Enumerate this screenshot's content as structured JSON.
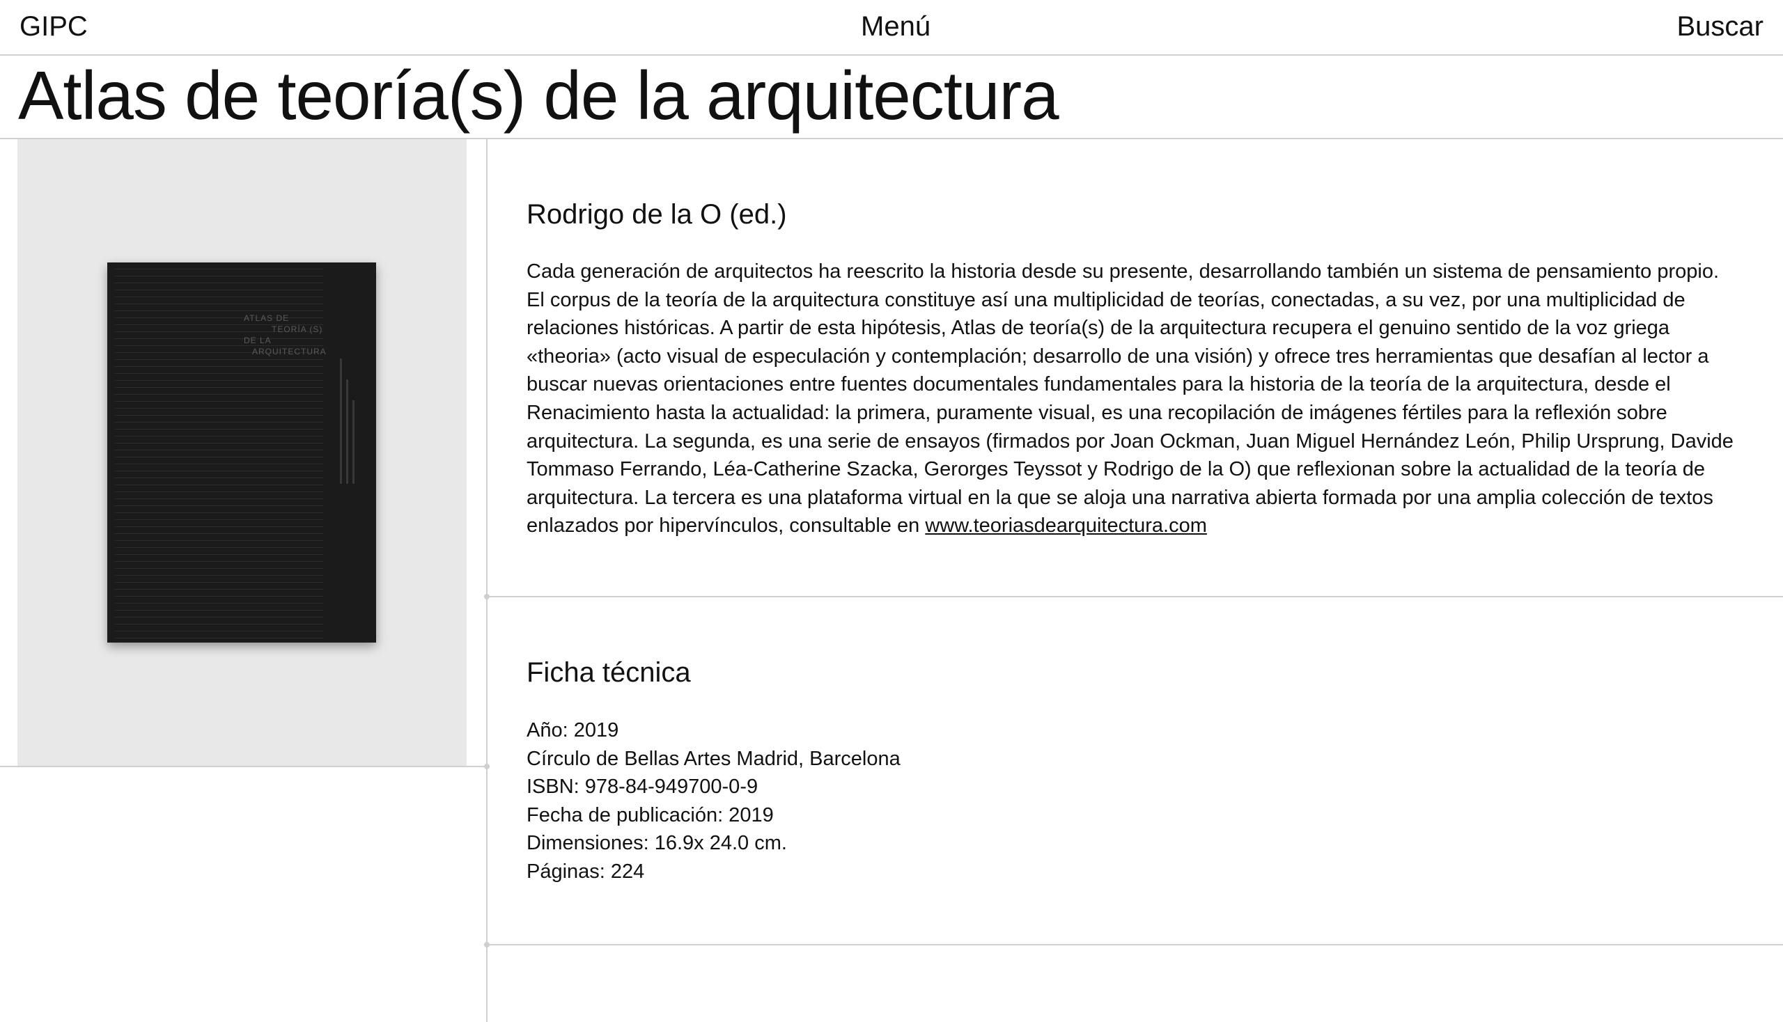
{
  "header": {
    "brand": "GIPC",
    "menu_label": "Menú",
    "search_label": "Buscar"
  },
  "page_title": "Atlas de teoría(s) de la arquitectura",
  "cover": {
    "title_lines": [
      "ATLAS DE",
      "TEORÍA (S)",
      "DE LA",
      "ARQUITECTURA"
    ]
  },
  "book": {
    "author": "Rodrigo de la O (ed.)",
    "description": "Cada generación de arquitectos ha reescrito la historia desde su presente, desarrollando también un sistema de pensamiento propio. El corpus de la teoría de la arquitectura constituye así una multiplicidad de teorías, conectadas, a su vez, por una multiplicidad de relaciones históricas. A partir de esta hipótesis, Atlas de teoría(s) de la arquitectura recupera el genuino sentido de la voz griega «theoria» (acto visual de especulación y contemplación; desarrollo de una visión) y ofrece tres herramientas que desafían al lector a buscar nuevas orientaciones entre fuentes documentales fundamentales para la historia de la teoría de la arquitectura, desde el Renacimiento hasta la actualidad: la primera, puramente visual, es una recopilación de imágenes fértiles para la reflexión sobre arquitectura. La segunda, es una serie de ensayos (firmados por Joan Ockman, Juan Miguel Hernández León, Philip Ursprung, Davide Tommaso Ferrando, Léa-Catherine Szacka, Gerorges Teyssot y Rodrigo de la O) que reflexionan sobre la actualidad de la teoría de arquitectura. La tercera es una plataforma virtual en la que se aloja una narrativa abierta formada por una amplia colección de textos enlazados por hipervínculos, consultable en",
    "link_text": "www.teoriasdearquitectura.com"
  },
  "ficha": {
    "title": "Ficha técnica",
    "specs": [
      "Año: 2019",
      "Círculo de Bellas Artes Madrid, Barcelona",
      "ISBN: 978-84-949700-0-9",
      "Fecha de publicación: 2019",
      "Dimensiones: 16.9x 24.0 cm.",
      "Páginas: 224"
    ]
  }
}
